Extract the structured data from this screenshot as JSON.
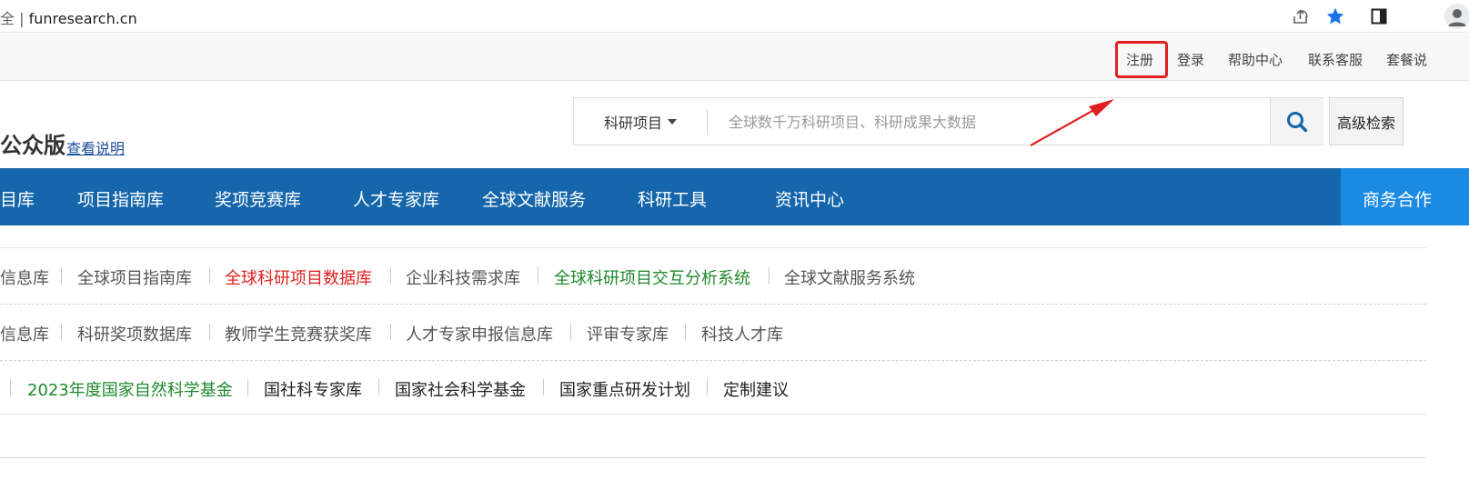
{
  "browser": {
    "security_prefix": "全",
    "url": "funresearch.cn",
    "icons": [
      "share-icon",
      "star-icon",
      "sidebar-icon",
      "profile-icon"
    ]
  },
  "utility_bar": {
    "register": "注册",
    "login": "登录",
    "help": "帮助中心",
    "contact": "联系客服",
    "plans": "套餐说"
  },
  "header": {
    "site_title": "公众版",
    "doc_link": "查看说明",
    "search": {
      "category": "科研项目",
      "placeholder": "全球数千万科研项目、科研成果大数据"
    },
    "advanced_search": "高级检索"
  },
  "nav": {
    "items": [
      "目库",
      "项目指南库",
      "奖项竞赛库",
      "人才专家库",
      "全球文献服务",
      "科研工具",
      "资讯中心"
    ],
    "business": "商务合作"
  },
  "rows": {
    "row1": [
      "信息库",
      "全球项目指南库",
      "全球科研项目数据库",
      "企业科技需求库",
      "全球科研项目交互分析系统",
      "全球文献服务系统"
    ],
    "row2": [
      "信息库",
      "科研奖项数据库",
      "教师学生竞赛获奖库",
      "人才专家申报信息库",
      "评审专家库",
      "科技人才库"
    ],
    "row3": [
      "2023年度国家自然科学基金",
      "国社科专家库",
      "国家社会科学基金",
      "国家重点研发计划",
      "定制建议"
    ]
  },
  "colors": {
    "nav_bg": "#1566aa",
    "nav_business_bg": "#1a8ae3",
    "highlight_red": "#e02020",
    "link_green": "#1e8a2c",
    "link_red": "#e02020"
  }
}
